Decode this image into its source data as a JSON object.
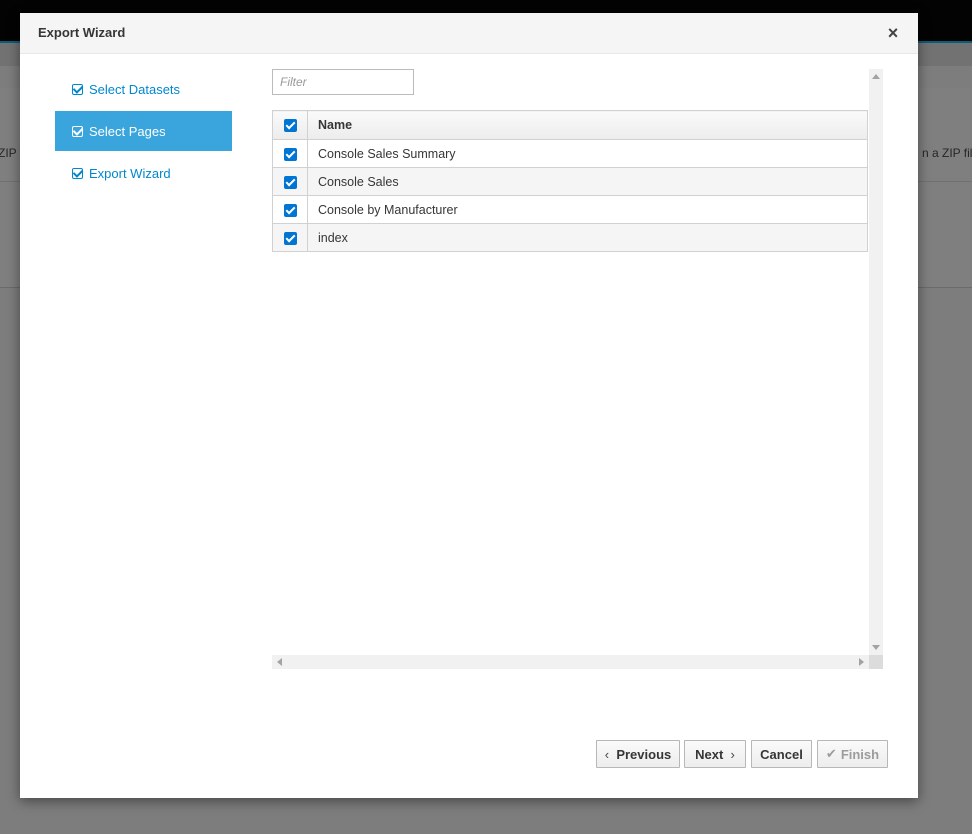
{
  "background": {
    "left_fragment": "ZIP fi",
    "right_fragment": "n a ZIP file"
  },
  "modal": {
    "title": "Export Wizard",
    "close_glyph": "×"
  },
  "steps": [
    {
      "label": "Select Datasets",
      "active": false
    },
    {
      "label": "Select Pages",
      "active": true
    },
    {
      "label": "Export Wizard",
      "active": false
    }
  ],
  "filter": {
    "placeholder": "Filter",
    "value": ""
  },
  "table": {
    "header": {
      "name": "Name",
      "all_checked": true
    },
    "rows": [
      {
        "name": "Console Sales Summary",
        "checked": true
      },
      {
        "name": "Console Sales",
        "checked": true
      },
      {
        "name": "Console by Manufacturer",
        "checked": true
      },
      {
        "name": "index",
        "checked": true
      }
    ]
  },
  "buttons": {
    "previous": "Previous",
    "next": "Next",
    "cancel": "Cancel",
    "finish": "Finish"
  },
  "colors": {
    "accent": "#39a5dc",
    "link": "#0088ce",
    "checkbox": "#0075d4"
  },
  "icons": {
    "step_status": "check-square-icon",
    "close": "close-icon",
    "prev_chevron": "chevron-left-icon",
    "next_chevron": "chevron-right-icon",
    "finish_check": "check-icon"
  }
}
